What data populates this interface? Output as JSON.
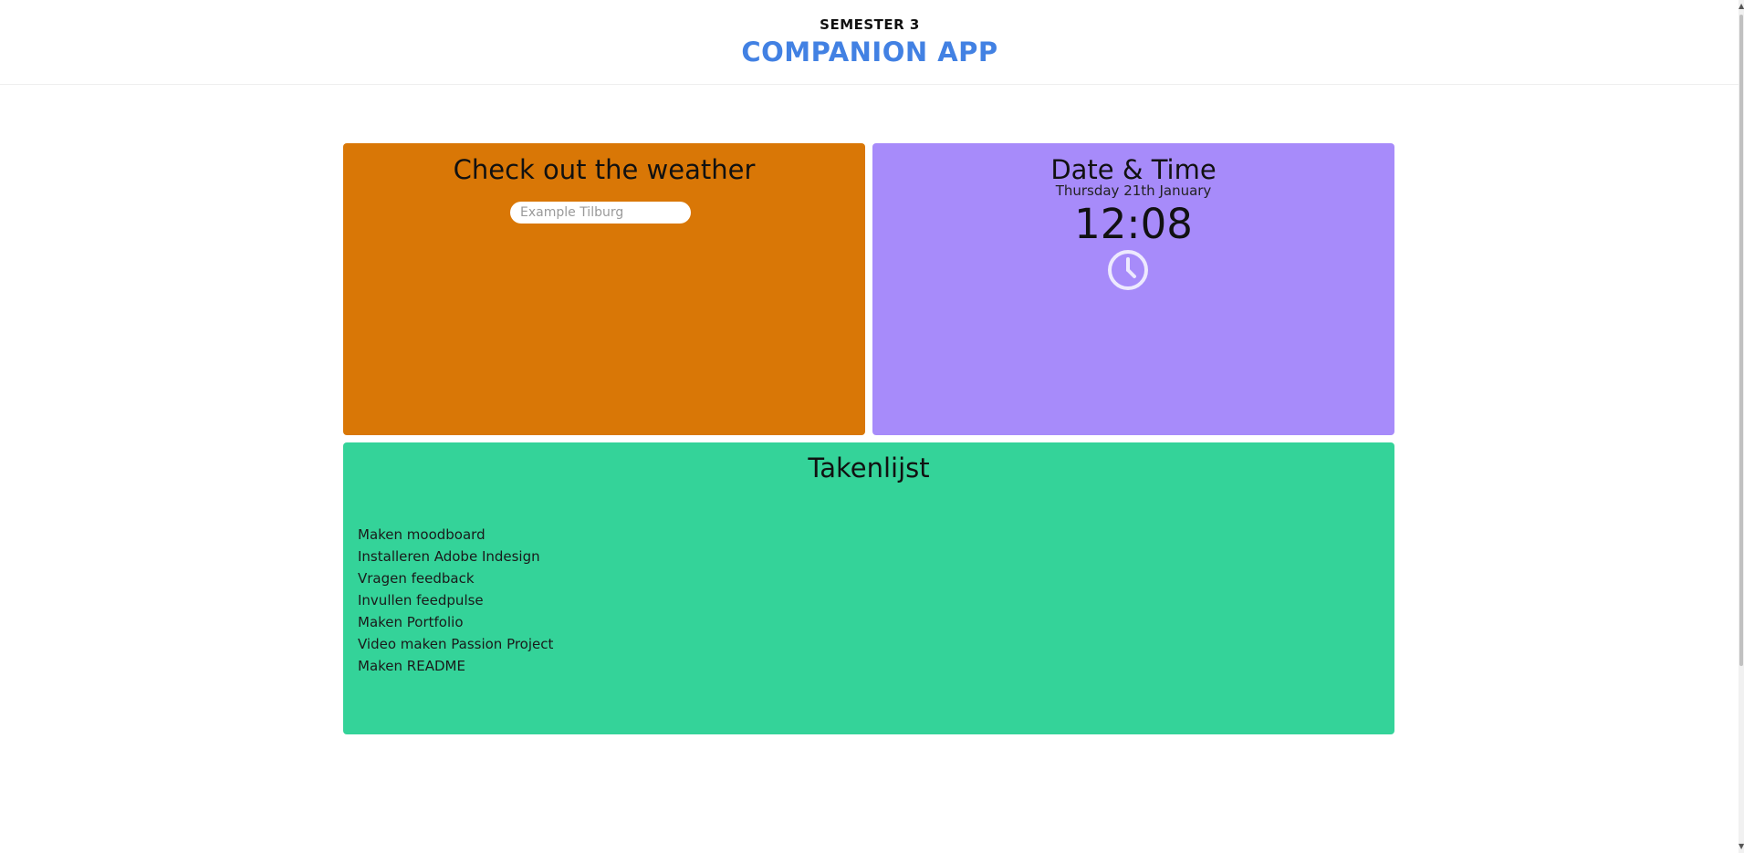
{
  "header": {
    "subtitle": "SEMESTER 3",
    "title": "COMPANION APP"
  },
  "weather": {
    "title": "Check out the weather",
    "search_placeholder": "Example Tilburg",
    "search_value": ""
  },
  "datetime": {
    "title": "Date & Time",
    "date": "Thursday 21th January",
    "time": "12:08",
    "icon": "clock-icon"
  },
  "tasks": {
    "title": "Takenlijst",
    "items": [
      "Maken moodboard",
      "Installeren Adobe Indesign",
      "Vragen feedback",
      "Invullen feedpulse",
      "Maken Portfolio",
      "Video maken Passion Project",
      "Maken README"
    ]
  },
  "colors": {
    "title_accent": "#4281e3",
    "weather_card": "#d97706",
    "datetime_card": "#a78bfa",
    "tasks_card": "#34d399"
  }
}
